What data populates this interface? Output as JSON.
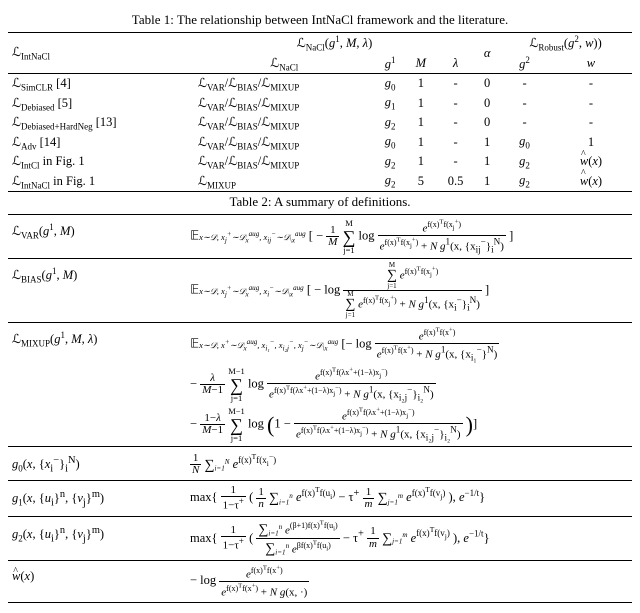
{
  "table1": {
    "caption": "Table 1: The relationship between IntNaCl framework and the literature.",
    "header": {
      "c1": "ℒ_IntNaCl",
      "nacl": "ℒ_NaCl(g¹, M, λ)",
      "nacl_sub1": "ℒ_NaCl",
      "nacl_sub2": "g¹",
      "nacl_sub3": "M",
      "nacl_sub4": "λ",
      "alpha": "α",
      "robust": "ℒ_Robust(g², w))",
      "robust_sub1": "g²",
      "robust_sub2": "w"
    },
    "rows": [
      {
        "name": "ℒ_SimCLR [4]",
        "nacl": "ℒ_VAR/ℒ_BIAS/ℒ_MIXUP",
        "g1": "g₀",
        "M": "1",
        "lam": "-",
        "alpha": "0",
        "g2": "-",
        "w": "-"
      },
      {
        "name": "ℒ_Debiased [5]",
        "nacl": "ℒ_VAR/ℒ_BIAS/ℒ_MIXUP",
        "g1": "g₁",
        "M": "1",
        "lam": "-",
        "alpha": "0",
        "g2": "-",
        "w": "-"
      },
      {
        "name": "ℒ_Debiased+HardNeg [13]",
        "nacl": "ℒ_VAR/ℒ_BIAS/ℒ_MIXUP",
        "g1": "g₂",
        "M": "1",
        "lam": "-",
        "alpha": "0",
        "g2": "-",
        "w": "-"
      },
      {
        "name": "ℒ_Adv [14]",
        "nacl": "ℒ_VAR/ℒ_BIAS/ℒ_MIXUP",
        "g1": "g₀",
        "M": "1",
        "lam": "-",
        "alpha": "1",
        "g2": "g₀",
        "w": "1"
      },
      {
        "name": "ℒ_IntCl in Fig. 1",
        "nacl": "ℒ_VAR/ℒ_BIAS/ℒ_MIXUP",
        "g1": "g₂",
        "M": "1",
        "lam": "-",
        "alpha": "1",
        "g2": "g₂",
        "w": "ŵ(x)"
      },
      {
        "name": "ℒ_IntNaCl in Fig. 1",
        "nacl": "ℒ_MIXUP",
        "g1": "g₂",
        "M": "5",
        "lam": "0.5",
        "alpha": "1",
        "g2": "g₂",
        "w": "ŵ(x)"
      }
    ]
  },
  "table2": {
    "caption": "Table 2: A summary of definitions.",
    "rows": {
      "var_label": "ℒ_VAR(g¹, M)",
      "bias_label": "ℒ_BIAS(g¹, M)",
      "mixup_label": "ℒ_MIXUP(g¹, M, λ)",
      "g0_label": "g₀(x, {xᵢ⁻}ᵢᴺ)",
      "g1_label": "g₁(x, {uᵢ}ⁿ, {vⱼ}ᵐ)",
      "g2_label": "g₂(x, {uᵢ}ⁿ, {vⱼ}ᵐ)",
      "wh_label": "ŵ(x)"
    }
  }
}
